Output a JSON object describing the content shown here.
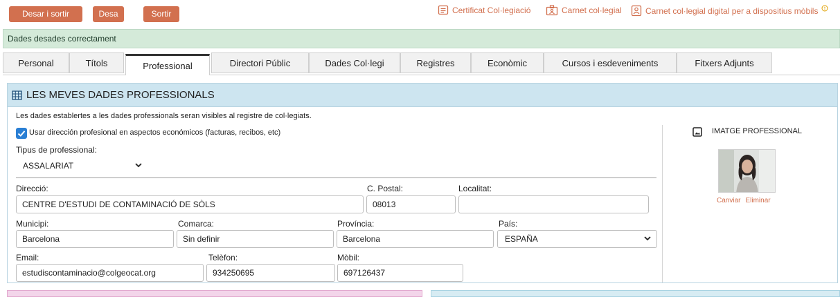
{
  "toolbar": {
    "save_exit": "Desar i sortir",
    "save": "Desa",
    "exit": "Sortir"
  },
  "links": {
    "certificate": "Certificat Col·legiació",
    "card": "Carnet col·legial",
    "digital_card": "Carnet col·legial digital per a dispositius mòbils"
  },
  "banner": {
    "message": "Dades desades correctament"
  },
  "tabs": [
    {
      "label": "Personal"
    },
    {
      "label": "Títols"
    },
    {
      "label": "Professional"
    },
    {
      "label": "Directori Públic"
    },
    {
      "label": "Dades Col·legi"
    },
    {
      "label": "Registres"
    },
    {
      "label": "Econòmic"
    },
    {
      "label": "Cursos i esdeveniments"
    },
    {
      "label": "Fitxers Adjunts"
    }
  ],
  "active_tab": "Professional",
  "section": {
    "title": "LES MEVES DADES PROFESSIONALS",
    "note": "Les dades establertes a les dades professionals seran visibles al registre de col·legiats.",
    "checkbox_label": "Usar dirección profesional en aspectos económicos (facturas, recibos, etc)",
    "checkbox_checked": true,
    "professional_type": {
      "label": "Tipus de professional:",
      "value": "ASSALARIAT"
    }
  },
  "address": {
    "direccio": {
      "label": "Direcció:",
      "value": "CENTRE D'ESTUDI DE CONTAMINACIÓ DE SÒLS"
    },
    "postal": {
      "label": "C. Postal:",
      "value": "08013"
    },
    "localitat": {
      "label": "Localitat:",
      "value": ""
    },
    "municipi": {
      "label": "Municipi:",
      "value": "Barcelona"
    },
    "comarca": {
      "label": "Comarca:",
      "value": "Sin definir"
    },
    "provincia": {
      "label": "Província:",
      "value": "Barcelona"
    },
    "pais": {
      "label": "País:",
      "value": "ESPAÑA"
    },
    "email": {
      "label": "Email:",
      "value": "estudiscontaminacio@colgeocat.org"
    },
    "telefon": {
      "label": "Telèfon:",
      "value": "934250695"
    },
    "mobil": {
      "label": "Mòbil:",
      "value": "697126437"
    }
  },
  "image": {
    "title": "IMATGE PROFESSIONAL",
    "change": "Canviar",
    "remove": "Eliminar"
  },
  "colors": {
    "accent": "#d2704f",
    "banner_bg": "#d4ead9",
    "panel_head": "#cde5f0",
    "checkbox": "#2a7fd4"
  }
}
